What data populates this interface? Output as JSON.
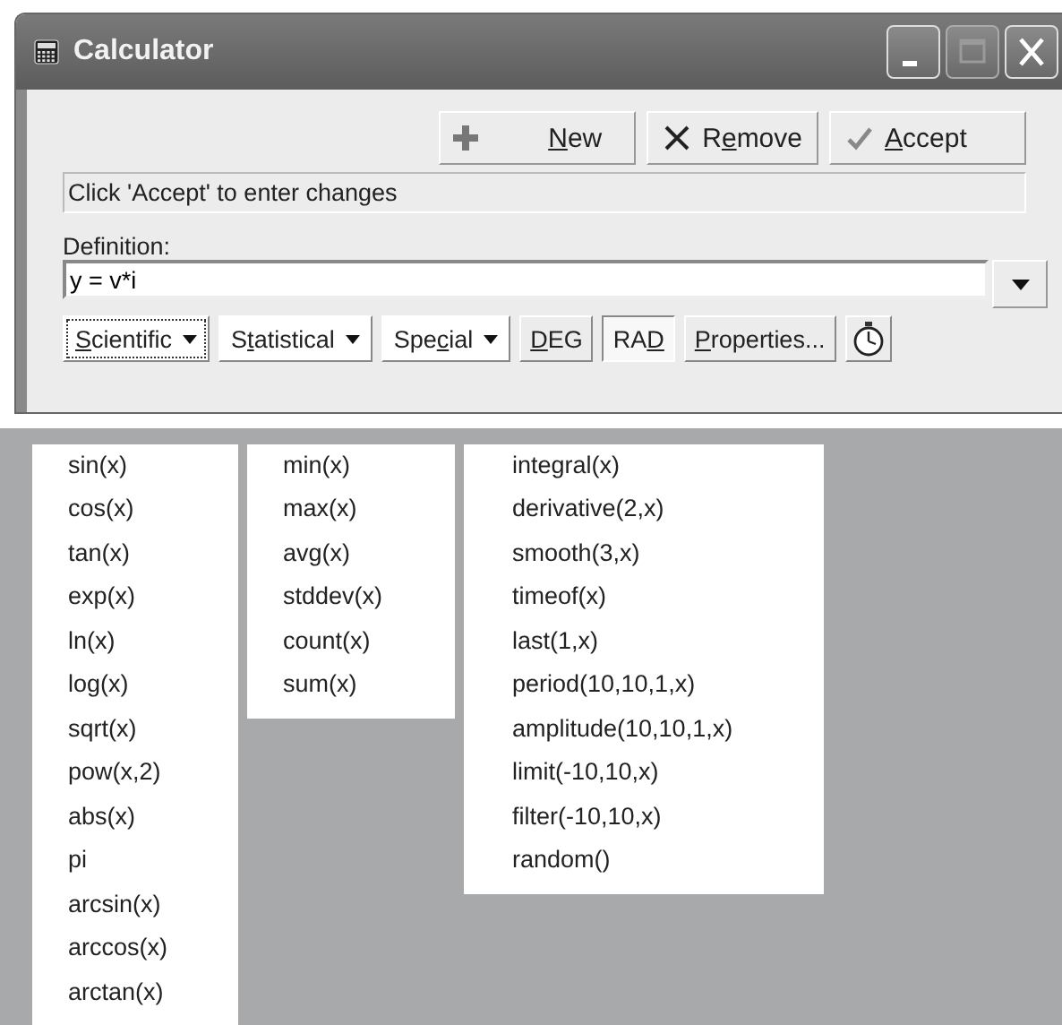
{
  "window": {
    "title": "Calculator"
  },
  "toolbar_buttons": [
    {
      "kind": "new",
      "access_key": "N",
      "label_end": "ew"
    },
    {
      "kind": "remove",
      "label_start": "R",
      "access_key": "e",
      "label_end": "move"
    },
    {
      "kind": "accept",
      "access_key": "A",
      "label_end": "ccept"
    }
  ],
  "status": "Click 'Accept' to enter changes",
  "definition": {
    "label": "Definition:",
    "value": "y = v*i"
  },
  "function_buttons": [
    {
      "kind": "menu",
      "access_key": "S",
      "label_end": "cientific",
      "focused": true
    },
    {
      "kind": "menu",
      "label_start": "S",
      "access_key": "t",
      "label_end": "atistical",
      "focused": false
    },
    {
      "kind": "menu",
      "label_start": "Spe",
      "access_key": "c",
      "label_end": "ial",
      "focused": false
    },
    {
      "kind": "toggle",
      "access_key": "D",
      "label_end": "EG",
      "selected": false
    },
    {
      "kind": "toggle",
      "label_start": "RA",
      "access_key": "D",
      "selected": true
    },
    {
      "kind": "push",
      "access_key": "P",
      "label_end": "roperties..."
    },
    {
      "kind": "timer"
    }
  ],
  "menus": [
    {
      "items": [
        "sin(x)",
        "cos(x)",
        "tan(x)",
        "exp(x)",
        "ln(x)",
        "log(x)",
        "sqrt(x)",
        "pow(x,2)",
        "abs(x)",
        "pi",
        "arcsin(x)",
        "arccos(x)",
        "arctan(x)"
      ]
    },
    {
      "items": [
        "min(x)",
        "max(x)",
        "avg(x)",
        "stddev(x)",
        "count(x)",
        "sum(x)"
      ]
    },
    {
      "items": [
        "integral(x)",
        "derivative(2,x)",
        "smooth(3,x)",
        "timeof(x)",
        "last(1,x)",
        "period(10,10,1,x)",
        "amplitude(10,10,1,x)",
        "limit(-10,10,x)",
        "filter(-10,10,x)",
        "random()"
      ]
    }
  ]
}
